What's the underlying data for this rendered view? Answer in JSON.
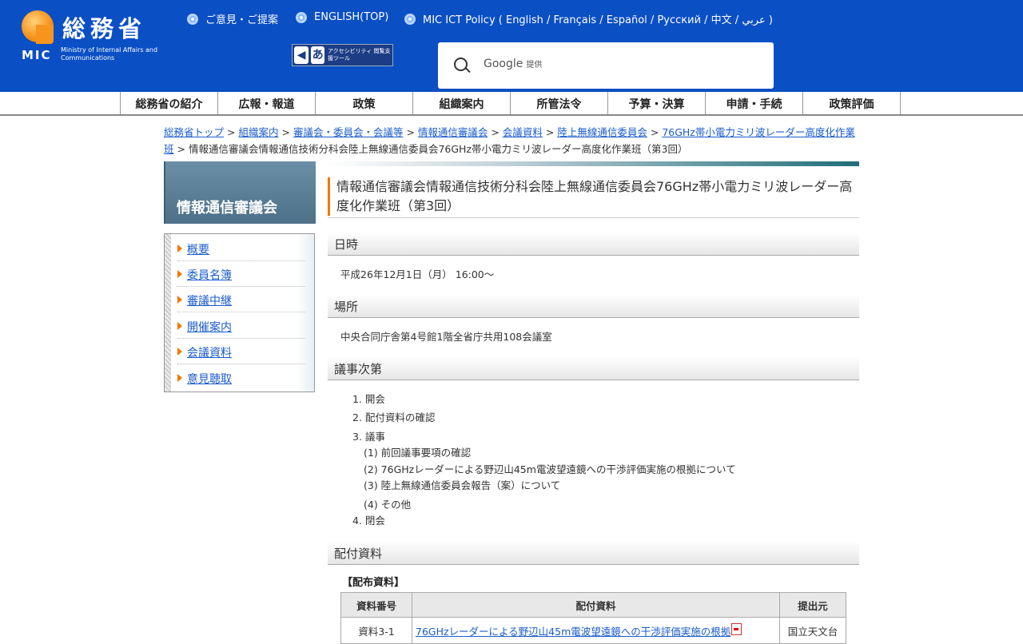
{
  "header": {
    "logo_kanji": "総務省",
    "logo_mic": "MIC",
    "logo_sub": "Ministry of Internal Affairs and Communications",
    "links": [
      {
        "label": "ご意見・ご提案"
      },
      {
        "label": "ENGLISH(TOP)"
      },
      {
        "label": "MIC ICT Policy ( English / Français / Español / Русский / 中文 / عربي )"
      }
    ],
    "accessibility_label": "アクセシビリティ 閲覧支援ツール",
    "search": {
      "brand": "Google",
      "sub": "提供",
      "icon": "search-icon"
    }
  },
  "nav": [
    "総務省の紹介",
    "広報・報道",
    "政策",
    "組織案内",
    "所管法令",
    "予算・決算",
    "申請・手続",
    "政策評価"
  ],
  "breadcrumb": {
    "links": [
      "総務省トップ",
      "組織案内",
      "審議会・委員会・会議等",
      "情報通信審議会",
      "会議資料",
      "陸上無線通信委員会",
      "76GHz帯小電力ミリ波レーダー高度化作業班"
    ],
    "separator": ">",
    "current": "情報通信審議会情報通信技術分科会陸上無線通信委員会76GHz帯小電力ミリ波レーダー高度化作業班（第3回）"
  },
  "sidebar": {
    "title": "情報通信審議会",
    "items": [
      "概要",
      "委員名簿",
      "審議中継",
      "開催案内",
      "会議資料",
      "意見聴取"
    ]
  },
  "main": {
    "title": "情報通信審議会情報通信技術分科会陸上無線通信委員会76GHz帯小電力ミリ波レーダー高度化作業班（第3回）",
    "datetime_heading": "日時",
    "datetime": "平成26年12月1日（月） 16:00～",
    "place_heading": "場所",
    "place": "中央合同庁舎第4号館1階全省庁共用108会議室",
    "agenda_heading": "議事次第",
    "agenda": [
      "1. 開会",
      "2. 配付資料の確認",
      "3. 議事",
      "4. 閉会"
    ],
    "agenda_sub": [
      "(1) 前回議事要項の確認",
      "(2) 76GHzレーダーによる野辺山45m電波望遠鏡への干渉評価実施の根拠について",
      "(3) 陸上無線通信委員会報告（案）について",
      "(4) その他"
    ],
    "materials_heading": "配付資料",
    "materials_subheading": "【配布資料】",
    "table": {
      "headers": [
        "資料番号",
        "配付資料",
        "提出元"
      ],
      "rows": [
        {
          "no": "資料3-1",
          "title": "76GHzレーダーによる野辺山45m電波望遠鏡への干渉評価実施の根拠",
          "from": "国立天文台"
        }
      ]
    }
  }
}
